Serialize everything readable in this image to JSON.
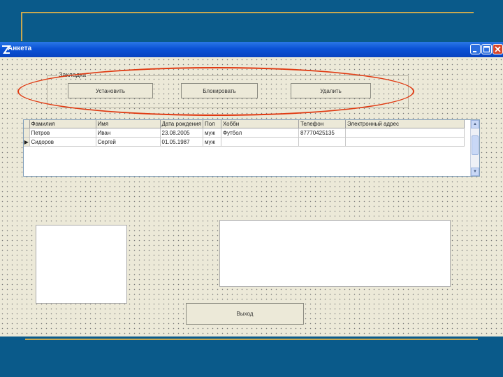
{
  "window": {
    "title": "Анкета"
  },
  "groupbox": {
    "label": "Закладка"
  },
  "buttons": {
    "add": "Установить",
    "search": "Блокировать",
    "delete": "Удалить",
    "exit": "Выход"
  },
  "grid": {
    "columns": [
      "Фамилия",
      "Имя",
      "Дата рождения",
      "Пол",
      "Хобби",
      "Телефон",
      "Электронный адрес"
    ],
    "rows": [
      [
        "Петров",
        "Иван",
        "23.08.2005",
        "муж",
        "Футбол",
        "87770425135",
        ""
      ],
      [
        "Сидоров",
        "Сергей",
        "01.05.1987",
        "муж",
        "",
        "",
        ""
      ]
    ],
    "current_row_marker": "▶"
  },
  "colors": {
    "slide_background": "#0a5a8a",
    "accent_line": "#c8a850",
    "titlebar": "#0b52d6",
    "form_background": "#ece9d8",
    "highlight_ellipse": "#e03a12"
  }
}
